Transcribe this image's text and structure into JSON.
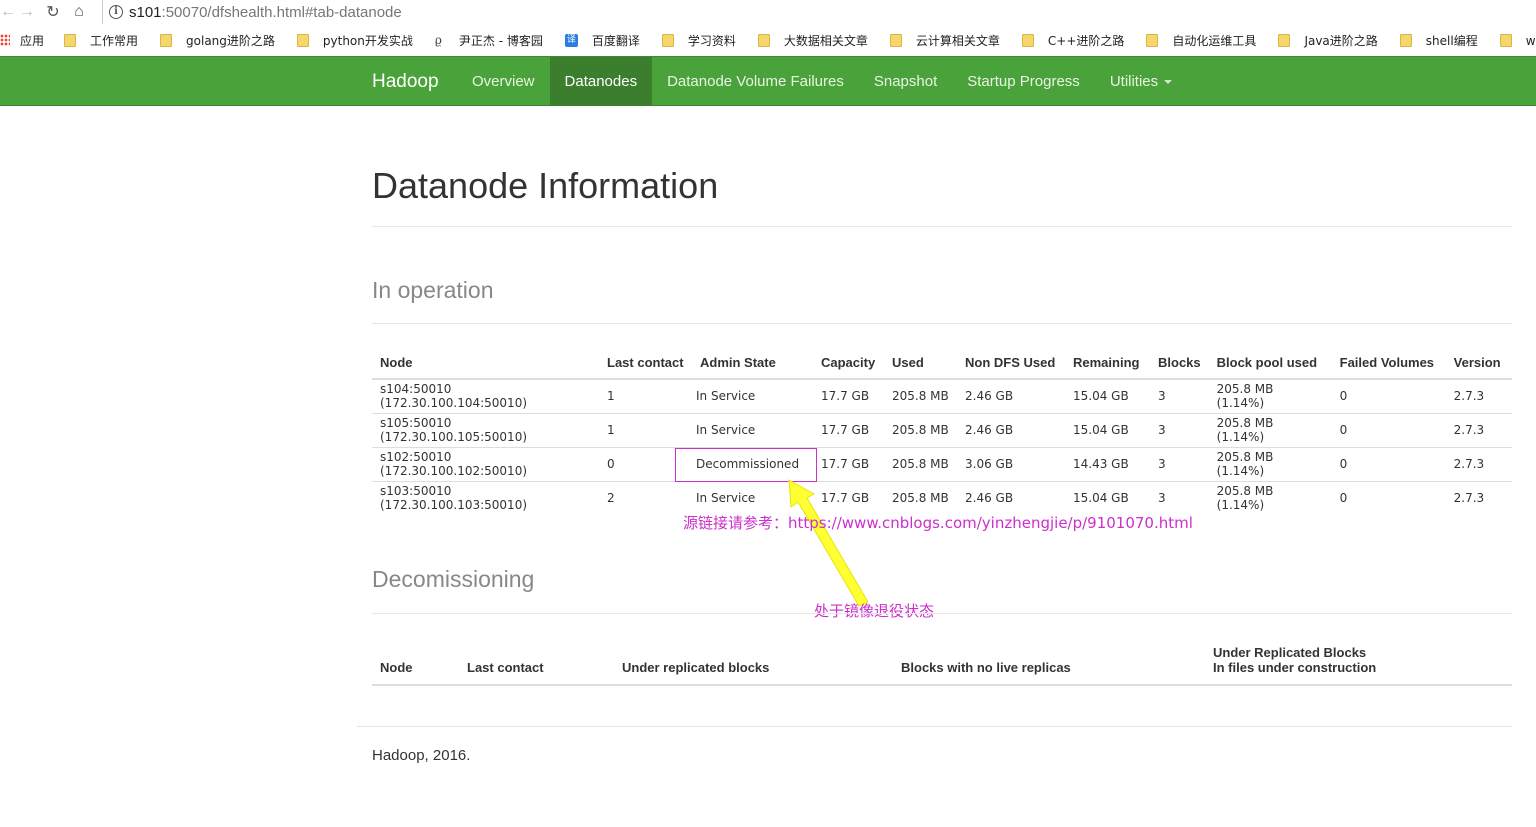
{
  "browser": {
    "url_host": "s101",
    "url_rest": ":50070/dfshealth.html#tab-datanode",
    "bookmarks": [
      "应用",
      "工作常用",
      "golang进阶之路",
      "python开发实战",
      "尹正杰 - 博客园",
      "百度翻译",
      "学习资料",
      "大数据相关文章",
      "云计算相关文章",
      "C++进阶之路",
      "自动化运维工具",
      "Java进阶之路",
      "shell编程",
      "windows常见的小问"
    ]
  },
  "navbar": {
    "brand": "Hadoop",
    "items": [
      "Overview",
      "Datanodes",
      "Datanode Volume Failures",
      "Snapshot",
      "Startup Progress",
      "Utilities"
    ],
    "active": "Datanodes"
  },
  "page": {
    "title": "Datanode Information",
    "in_operation": "In operation",
    "decommissioning": "Decomissioning",
    "footer": "Hadoop, 2016."
  },
  "ops_table": {
    "headers": [
      "Node",
      "Last contact",
      "Admin State",
      "Capacity",
      "Used",
      "Non DFS Used",
      "Remaining",
      "Blocks",
      "Block pool used",
      "Failed Volumes",
      "Version"
    ],
    "rows": [
      [
        "s104:50010 (172.30.100.104:50010)",
        "1",
        "In Service",
        "17.7 GB",
        "205.8 MB",
        "2.46 GB",
        "15.04 GB",
        "3",
        "205.8 MB (1.14%)",
        "0",
        "2.7.3"
      ],
      [
        "s105:50010 (172.30.100.105:50010)",
        "1",
        "In Service",
        "17.7 GB",
        "205.8 MB",
        "2.46 GB",
        "15.04 GB",
        "3",
        "205.8 MB (1.14%)",
        "0",
        "2.7.3"
      ],
      [
        "s102:50010 (172.30.100.102:50010)",
        "0",
        "Decommissioned",
        "17.7 GB",
        "205.8 MB",
        "3.06 GB",
        "14.43 GB",
        "3",
        "205.8 MB (1.14%)",
        "0",
        "2.7.3"
      ],
      [
        "s103:50010 (172.30.100.103:50010)",
        "2",
        "In Service",
        "17.7 GB",
        "205.8 MB",
        "2.46 GB",
        "15.04 GB",
        "3",
        "205.8 MB (1.14%)",
        "0",
        "2.7.3"
      ]
    ]
  },
  "decom_table": {
    "headers": [
      "Node",
      "Last contact",
      "Under replicated blocks",
      "Blocks with no live replicas",
      "Under Replicated Blocks",
      "In files under construction"
    ]
  },
  "annotations": {
    "source_label": "源链接请参考：",
    "source_url": "https://www.cnblogs.com/yinzhengjie/p/9101070.html",
    "arrow_note": "处于镜像退役状态",
    "annotation_color": "#cc2fcc",
    "arrow_color": "#ffff00"
  }
}
